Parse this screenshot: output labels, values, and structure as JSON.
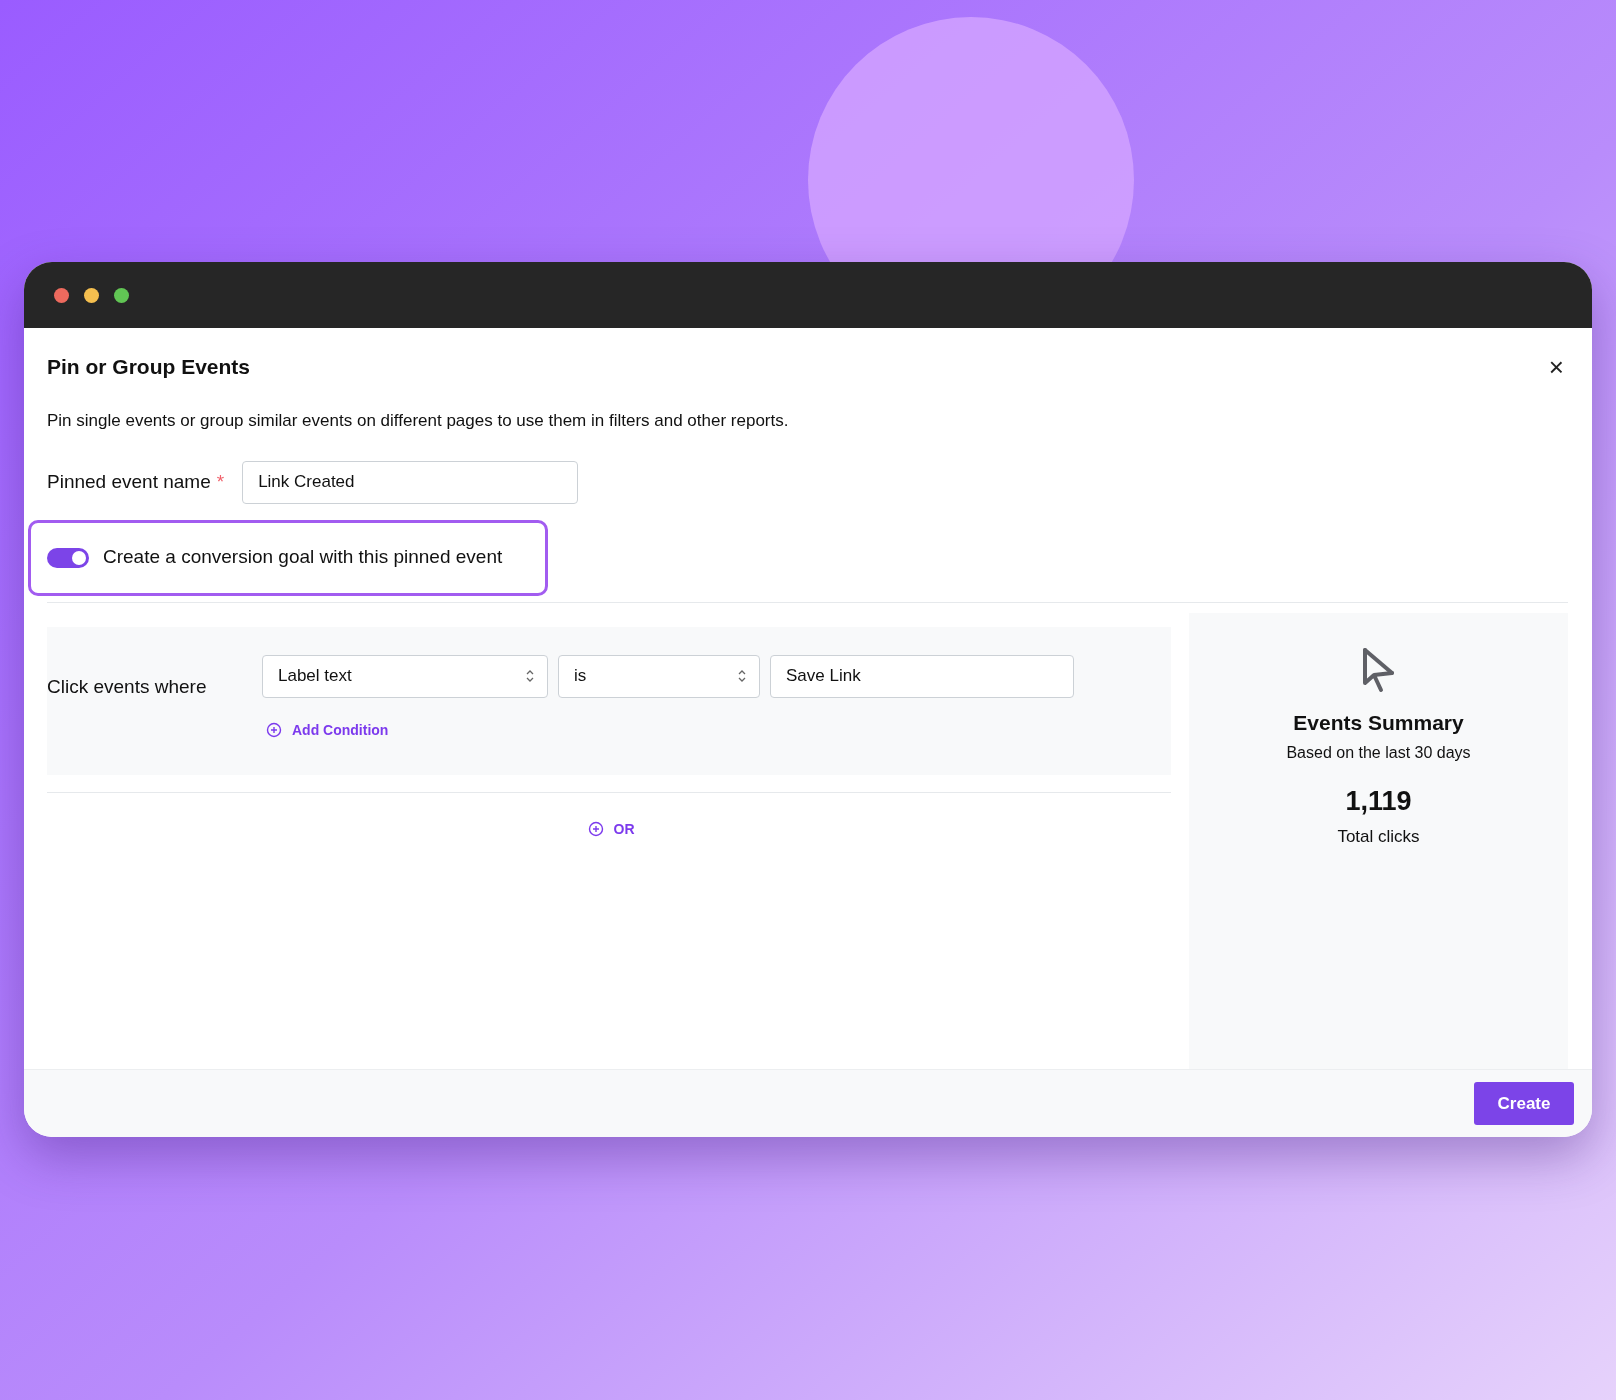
{
  "window": {
    "traffic_lights": [
      {
        "color": "#ed6a5e"
      },
      {
        "color": "#f5bf4f"
      },
      {
        "color": "#61c554"
      }
    ]
  },
  "dialog": {
    "title": "Pin or Group Events",
    "close": "×",
    "description": "Pin single events or group similar events on different pages to use them in filters and other reports.",
    "name_field": {
      "label": "Pinned event name",
      "required": true,
      "required_mark": "*",
      "value": "Link Created"
    },
    "goal_toggle": {
      "label": "Create a conversion goal with this pinned event",
      "on": true,
      "highlighted": true
    },
    "rule": {
      "label": "Click events where",
      "conditions": [
        {
          "field": "Label text",
          "operator": "is",
          "value": "Save Link"
        }
      ],
      "add_condition": "Add Condition",
      "or_button": "OR"
    },
    "summary": {
      "title": "Events Summary",
      "subtitle": "Based on the last 30 days",
      "total": "1,119",
      "total_label": "Total clicks"
    },
    "footer": {
      "create_button": "Create"
    }
  }
}
